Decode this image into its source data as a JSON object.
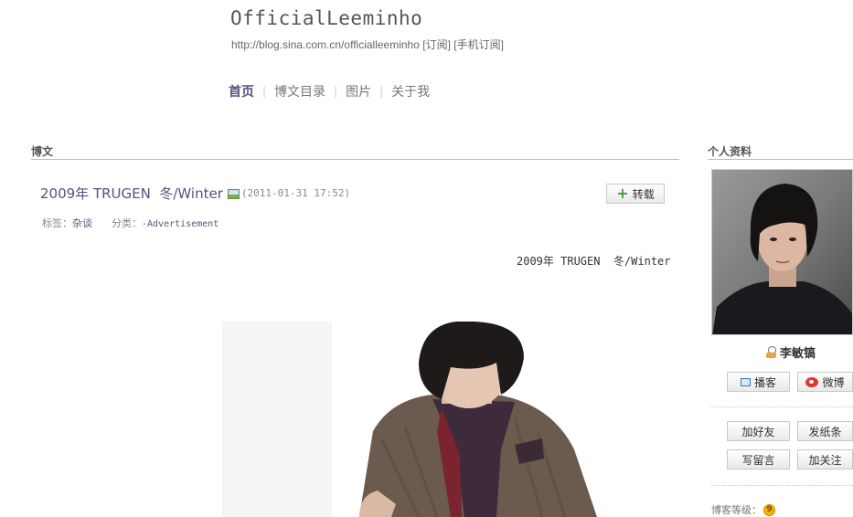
{
  "header": {
    "title": "OfficialLeeminho",
    "url": "http://blog.sina.com.cn/officialleeminho",
    "subscribe": "[订阅]",
    "mobile_subscribe": "[手机订阅]"
  },
  "nav": {
    "items": [
      "首页",
      "博文目录",
      "图片",
      "关于我"
    ]
  },
  "main": {
    "section_title": "博文",
    "post": {
      "title": "2009年 TRUGEN  冬/Winter",
      "date": "(2011-01-31 17:52)",
      "reprint_label": "转载",
      "tags_label": "标签：",
      "tag": "杂谈",
      "category_label": "分类：",
      "category": "-Advertisement",
      "body_text": "2009年 TRUGEN  冬/Winter"
    }
  },
  "sidebar": {
    "section_title": "个人资料",
    "name": "李敏镐",
    "buttons": {
      "bokan": "播客",
      "weibo": "微博",
      "add_friend": "加好友",
      "send_note": "发纸条",
      "leave_message": "写留言",
      "follow": "加关注"
    },
    "level_label": "博客等级：",
    "level_value": "9"
  },
  "colors": {
    "accent": "#5a4f7c",
    "weibo": "#e5332a",
    "plus": "#3aa23a"
  }
}
